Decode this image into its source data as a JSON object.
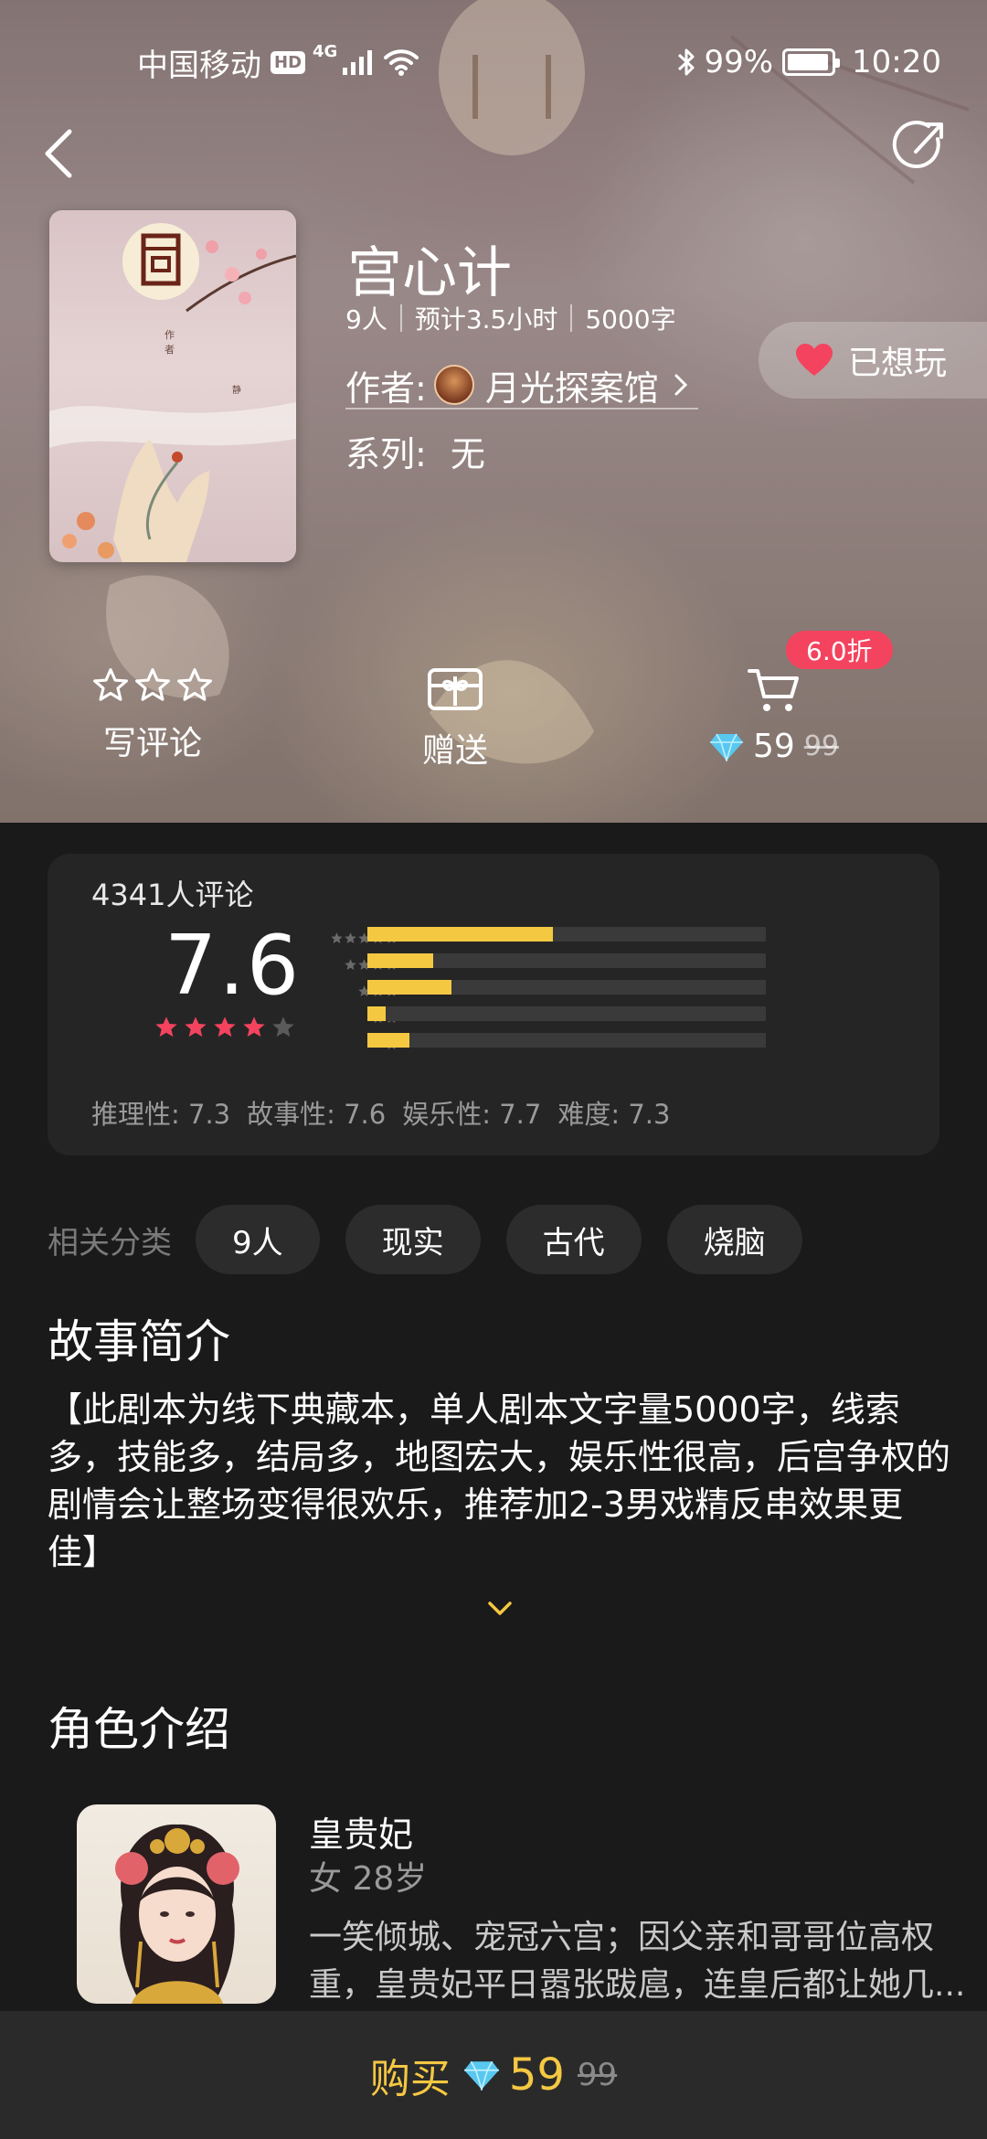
{
  "status_bar": {
    "carrier": "中国移动",
    "hd": "HD",
    "network": "4G",
    "battery": "99%",
    "time": "10:20"
  },
  "script": {
    "title": "宫心计",
    "players": "9人",
    "duration": "预计3.5小时",
    "words": "5000字",
    "author_label": "作者:",
    "author": "月光探案馆",
    "series_label": "系列:",
    "series": "无",
    "want_label": "已想玩"
  },
  "actions": {
    "review_label": "写评论",
    "gift_label": "赠送",
    "discount": "6.0折",
    "price": "59",
    "original_price": "99"
  },
  "rating": {
    "count_text": "4341人评论",
    "score": "7.6",
    "stars_filled": 4,
    "distribution": [
      0.465,
      0.165,
      0.21,
      0.045,
      0.105
    ],
    "sub": [
      {
        "label": "推理性:",
        "value": "7.3"
      },
      {
        "label": "故事性:",
        "value": "7.6"
      },
      {
        "label": "娱乐性:",
        "value": "7.7"
      },
      {
        "label": "难度:",
        "value": "7.3"
      }
    ]
  },
  "tags": {
    "label": "相关分类",
    "items": [
      "9人",
      "现实",
      "古代",
      "烧脑"
    ]
  },
  "story": {
    "heading": "故事简介",
    "text": "【此剧本为线下典藏本，单人剧本文字量5000字，线索多，技能多，结局多，地图宏大，娱乐性很高，后宫争权的剧情会让整场变得很欢乐，推荐加2-3男戏精反串效果更佳】"
  },
  "characters": {
    "heading": "角色介绍",
    "items": [
      {
        "name": "皇贵妃",
        "info": "女  28岁",
        "desc": "一笑倾城、宠冠六宫；因父亲和哥哥位高权重，皇贵妃平日嚣张跋扈，连皇后都让她几..."
      }
    ]
  },
  "bottom": {
    "buy_label": "购买",
    "price": "59",
    "original_price": "99"
  },
  "colors": {
    "accent_gold": "#f5c842",
    "accent_pink": "#f4435e",
    "background": "#1a1a1a",
    "card": "#252525"
  }
}
